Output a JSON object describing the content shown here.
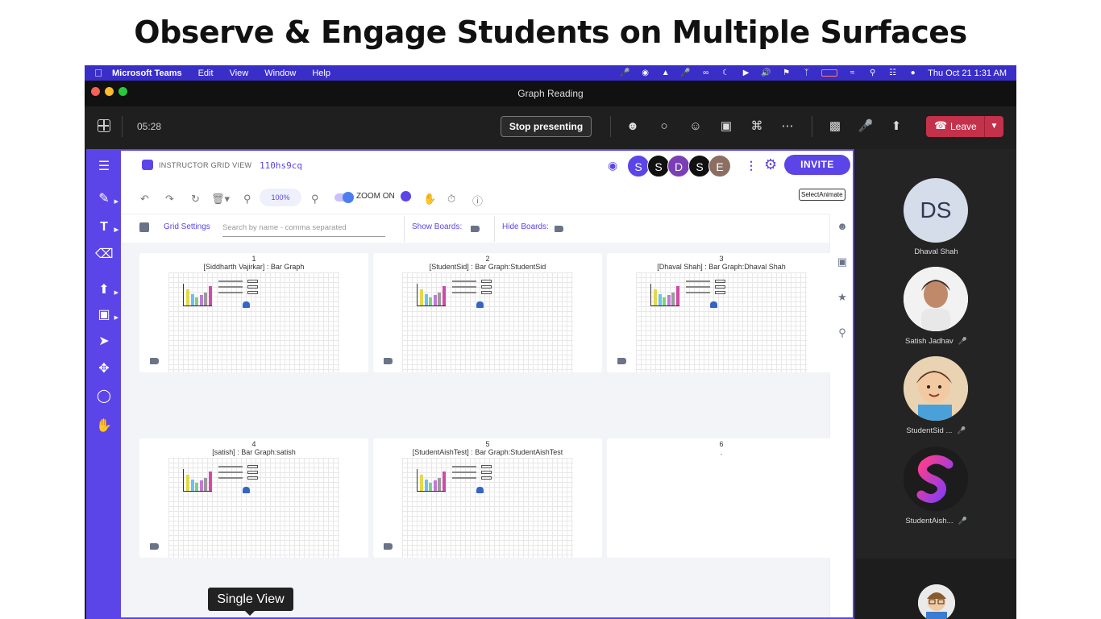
{
  "headline": "Observe & Engage Students on Multiple Surfaces",
  "menubar": {
    "items": [
      "Microsoft Teams",
      "Edit",
      "View",
      "Window",
      "Help"
    ],
    "clock": "Thu Oct 21  1:31 AM"
  },
  "window": {
    "title": "Graph Reading"
  },
  "teams": {
    "timer": "05:28",
    "stop_presenting": "Stop presenting",
    "leave": "Leave"
  },
  "app": {
    "name": "INSTRUCTOR GRID VIEW",
    "room_code": "110hs9cq",
    "avatars": [
      {
        "letter": "S",
        "color": "#5b45e8"
      },
      {
        "letter": "S",
        "color": "#111111"
      },
      {
        "letter": "D",
        "color": "#7b3fb5"
      },
      {
        "letter": "S",
        "color": "#111111"
      },
      {
        "letter": "E",
        "color": "#8d6e63"
      }
    ],
    "invite": "INVITE",
    "zoom_value": "100%",
    "zoom_label": "ZOOM ON",
    "select_animate": "SelectAnimate",
    "grid_settings": "Grid Settings",
    "search_placeholder": "Search by name - comma separated",
    "show_boards": "Show Boards:",
    "hide_boards": "Hide Boards:"
  },
  "boards": [
    {
      "num": "1",
      "label": "[Siddharth Vajirkar] : Bar Graph"
    },
    {
      "num": "2",
      "label": "[StudentSid] : Bar Graph:StudentSid"
    },
    {
      "num": "3",
      "label": "[Dhaval Shah] : Bar Graph:Dhaval Shah"
    },
    {
      "num": "4",
      "label": "[satish] : Bar Graph:satish"
    },
    {
      "num": "5",
      "label": "[StudentAishTest] : Bar Graph:StudentAishTest"
    },
    {
      "num": "6",
      "label": "."
    }
  ],
  "participants": [
    {
      "name": "Dhaval Shah",
      "initials": "DS"
    },
    {
      "name": "Satish Jadhav"
    },
    {
      "name": "StudentSid ..."
    },
    {
      "name": "StudentAish..."
    }
  ],
  "tooltip": "Single View",
  "colors": {
    "accent": "#5b45e8",
    "leave": "#c4314b",
    "menubar": "#3a2ec9"
  }
}
